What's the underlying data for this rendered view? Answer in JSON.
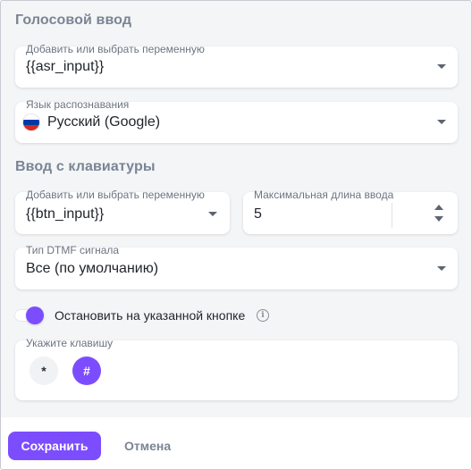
{
  "voice": {
    "title": "Голосовой ввод",
    "variable": {
      "label": "Добавить или выбрать переменную",
      "value": "{{asr_input}}"
    },
    "language": {
      "label": "Язык распознавания",
      "value": "Русский (Google)",
      "flag_colors": [
        "#ffffff",
        "#0039a6",
        "#d52b1e"
      ]
    }
  },
  "keyboard": {
    "title": "Ввод с клавиатуры",
    "variable": {
      "label": "Добавить или выбрать переменную",
      "value": "{{btn_input}}"
    },
    "max_length": {
      "label": "Максимальная длина ввода",
      "value": "5"
    },
    "dtmf": {
      "label": "Тип DTMF сигнала",
      "value": "Все (по умолчанию)"
    },
    "stop_toggle": {
      "label": "Остановить на указанной кнопке",
      "on": true
    },
    "keys": {
      "label": "Укажите клавишу",
      "items": [
        {
          "symbol": "*",
          "selected": false
        },
        {
          "symbol": "#",
          "selected": true
        }
      ]
    }
  },
  "footer": {
    "save_label": "Сохранить",
    "cancel_label": "Отмена"
  },
  "colors": {
    "accent": "#7c4dff",
    "section_title": "#7a8594"
  }
}
